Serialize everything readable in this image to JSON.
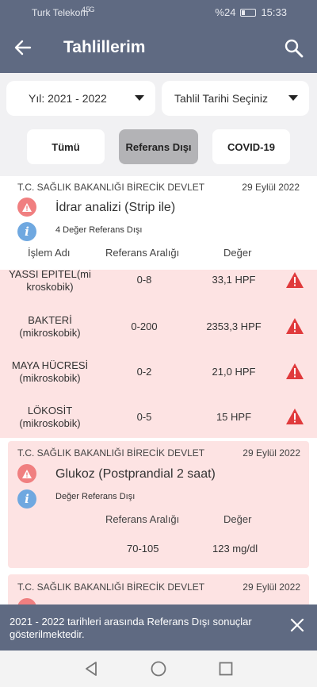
{
  "status": {
    "carrier": "Turk Telekom",
    "signal": "4.5G",
    "battery": "%24",
    "time": "15:33"
  },
  "appbar": {
    "title": "Tahlillerim",
    "back_icon": "arrow-left-icon",
    "search_icon": "search-icon"
  },
  "filters": {
    "year": "Yıl: 2021 - 2022",
    "date": "Tahlil Tarihi Seçiniz",
    "chips": [
      "Tümü",
      "Referans Dışı",
      "COVID-19"
    ],
    "active_chip": "Referans Dışı"
  },
  "results": [
    {
      "institution": "T.C. SAĞLIK BAKANLIĞI BİRECİK DEVLET",
      "date": "29 Eylül 2022",
      "test": "İdrar analizi (Strip ile)",
      "note": "4 Değer Referans Dışı",
      "headers": {
        "name": "İşlem Adı",
        "range": "Referans Aralığı",
        "value": "Değer"
      },
      "rows": [
        {
          "name1": "YASSI EPITEL(mi",
          "name2": "kroskobik)",
          "range": "0-8",
          "value": "33,1 HPF"
        },
        {
          "name1": "BAKTERİ",
          "name2": "(mikroskobik)",
          "range": "0-200",
          "value": "2353,3 HPF"
        },
        {
          "name1": "MAYA HÜCRESİ",
          "name2": "(mikroskobik)",
          "range": "0-2",
          "value": "21,0 HPF"
        },
        {
          "name1": "LÖKOSİT",
          "name2": "(mikroskobik)",
          "range": "0-5",
          "value": "15 HPF"
        }
      ]
    },
    {
      "institution": "T.C. SAĞLIK BAKANLIĞI BİRECİK DEVLET",
      "date": "29 Eylül 2022",
      "test": "Glukoz (Postprandial 2 saat)",
      "note": "Değer Referans Dışı",
      "headers": {
        "range": "Referans Aralığı",
        "value": "Değer"
      },
      "range": "70-105",
      "value": "123 mg/dl"
    },
    {
      "institution": "T.C. SAĞLIK BAKANLIĞI BİRECİK DEVLET",
      "date": "29 Eylül 2022"
    }
  ],
  "snackbar": {
    "message": "2021 - 2022 tarihleri arasında Referans Dışı sonuçlar gösterilmektedir.",
    "close_icon": "close-icon"
  },
  "colors": {
    "primary": "#5f6a82",
    "alert_bg": "#fde3e3",
    "warning": "#e03a3c",
    "info": "#6fa8e0"
  }
}
